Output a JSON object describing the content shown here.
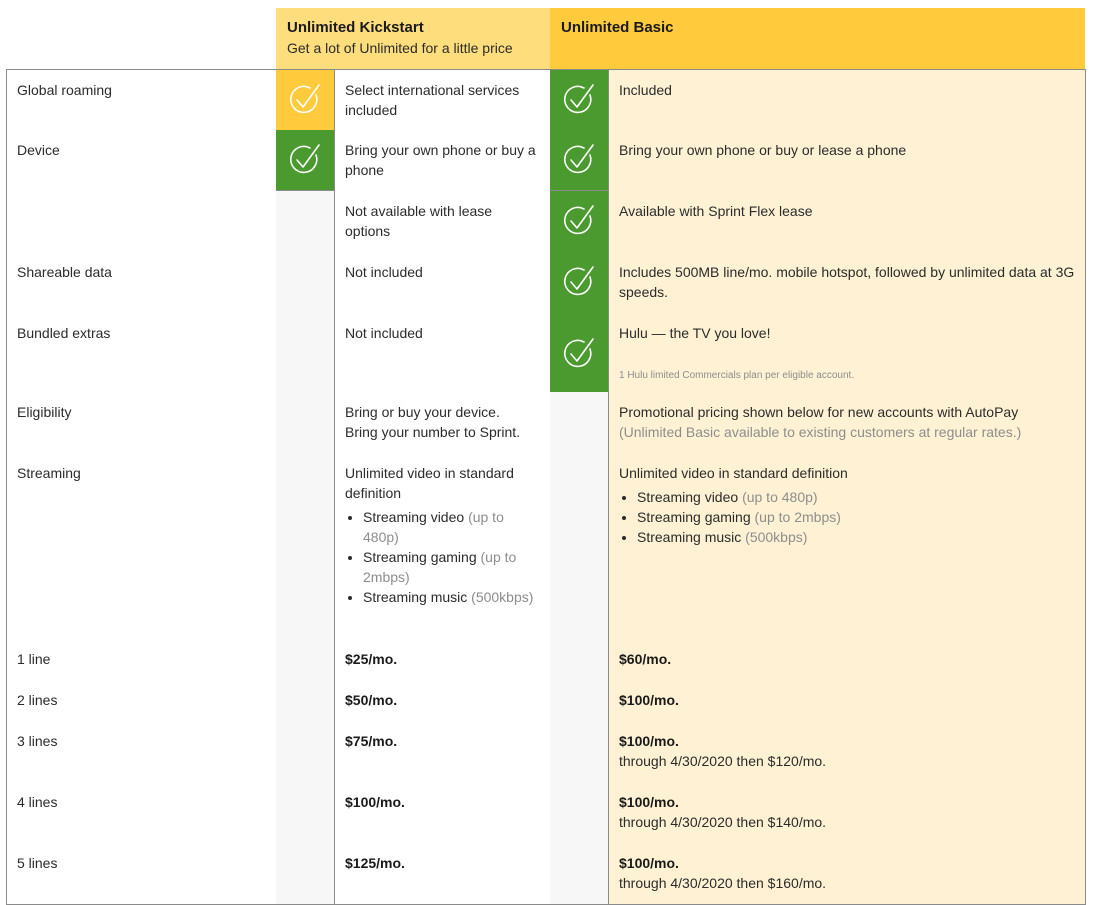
{
  "plans": [
    {
      "name": "Unlimited Kickstart",
      "tagline": "Get a lot of Unlimited for a little price"
    },
    {
      "name": "Unlimited Basic",
      "tagline": ""
    }
  ],
  "colors": {
    "kickstart_header": "#fedd7d",
    "basic_header": "#ffcb3c",
    "included_green": "#4b9a2f",
    "partial_yellow": "#ffcb3c",
    "basic_cell_bg": "#fff2d4",
    "empty_icon_bg": "#f7f7f7"
  },
  "rows": {
    "global_roaming": {
      "label": "Global roaming",
      "kickstart": {
        "icon": "check-circle-icon",
        "status": "partial",
        "text": "Select international services included"
      },
      "basic": {
        "icon": "check-circle-icon",
        "status": "included",
        "text": "Included"
      }
    },
    "device": {
      "label": "Device",
      "sub": [
        {
          "kickstart": {
            "icon": "check-circle-icon",
            "status": "included",
            "text": "Bring your own phone or buy a phone"
          },
          "basic": {
            "icon": "check-circle-icon",
            "status": "included",
            "text": "Bring your own phone or buy or lease a phone"
          }
        },
        {
          "kickstart": {
            "icon": "",
            "status": "none",
            "text": "Not available with lease options"
          },
          "basic": {
            "icon": "check-circle-icon",
            "status": "included",
            "text": "Available with Sprint Flex lease"
          }
        }
      ]
    },
    "shareable_data": {
      "label": "Shareable data",
      "kickstart": {
        "icon": "",
        "status": "none",
        "text": "Not included"
      },
      "basic": {
        "icon": "check-circle-icon",
        "status": "included",
        "text": "Includes 500MB line/mo. mobile hotspot, followed by unlimited data at 3G speeds."
      }
    },
    "bundled_extras": {
      "label": "Bundled extras",
      "kickstart": {
        "icon": "",
        "status": "none",
        "text": "Not included"
      },
      "basic": {
        "icon": "check-circle-icon",
        "status": "included",
        "text": "Hulu — the TV you love!",
        "note": "1 Hulu limited Commercials plan per eligible account."
      }
    },
    "eligibility": {
      "label": "Eligibility",
      "kickstart": {
        "line1": "Bring or buy your device.",
        "line2": "Bring your number to Sprint."
      },
      "basic": {
        "line1": "Promotional pricing shown below for new accounts with AutoPay",
        "line2": "(Unlimited Basic available to existing customers at regular rates.)"
      }
    },
    "streaming": {
      "label": "Streaming",
      "kickstart": {
        "intro": "Unlimited video in standard definition",
        "items": [
          {
            "name": "Streaming video",
            "detail": "(up to 480p)"
          },
          {
            "name": "Streaming gaming",
            "detail": "(up to 2mbps)"
          },
          {
            "name": "Streaming music",
            "detail": "(500kbps)"
          }
        ]
      },
      "basic": {
        "intro": "Unlimited video in standard definition",
        "items": [
          {
            "name": "Streaming video",
            "detail": "(up to 480p)"
          },
          {
            "name": "Streaming gaming",
            "detail": "(up to 2mbps)"
          },
          {
            "name": "Streaming music",
            "detail": "(500kbps)"
          }
        ]
      }
    },
    "pricing": [
      {
        "label": "1 line",
        "kickstart": "$25/mo.",
        "basic": "$60/mo.",
        "basic_note": ""
      },
      {
        "label": "2 lines",
        "kickstart": "$50/mo.",
        "basic": "$100/mo.",
        "basic_note": ""
      },
      {
        "label": "3 lines",
        "kickstart": "$75/mo.",
        "basic": "$100/mo.",
        "basic_note": "through 4/30/2020 then $120/mo."
      },
      {
        "label": "4 lines",
        "kickstart": "$100/mo.",
        "basic": "$100/mo.",
        "basic_note": "through 4/30/2020 then $140/mo."
      },
      {
        "label": "5 lines",
        "kickstart": "$125/mo.",
        "basic": "$100/mo.",
        "basic_note": "through 4/30/2020 then $160/mo."
      }
    ]
  }
}
